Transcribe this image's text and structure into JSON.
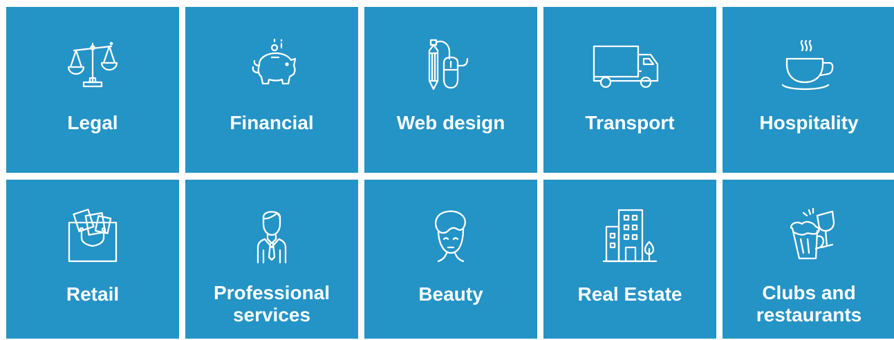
{
  "colors": {
    "tile_background": "#2493c6",
    "text": "#ffffff"
  },
  "tiles": [
    {
      "icon": "scales-icon",
      "label": "Legal"
    },
    {
      "icon": "piggy-bank-icon",
      "label": "Financial"
    },
    {
      "icon": "pencil-mouse-icon",
      "label": "Web design"
    },
    {
      "icon": "truck-icon",
      "label": "Transport"
    },
    {
      "icon": "coffee-cup-icon",
      "label": "Hospitality"
    },
    {
      "icon": "shopping-bag-icon",
      "label": "Retail"
    },
    {
      "icon": "businessman-icon",
      "label_line1": "Professional",
      "label_line2": "services"
    },
    {
      "icon": "woman-face-icon",
      "label": "Beauty"
    },
    {
      "icon": "building-icon",
      "label": "Real Estate"
    },
    {
      "icon": "cheers-icon",
      "label_line1": "Clubs and",
      "label_line2": "restaurants"
    }
  ]
}
